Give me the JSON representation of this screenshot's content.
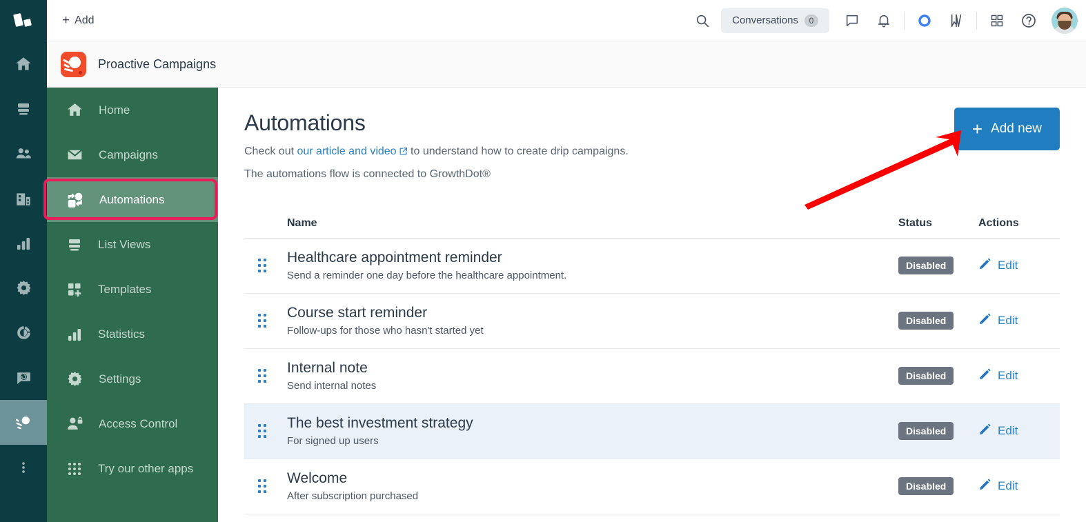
{
  "rail": {
    "logo_icon": "app-logo-icon",
    "items": [
      {
        "name": "home",
        "icon": "home-icon",
        "active": false
      },
      {
        "name": "knowledge-base",
        "icon": "book-icon",
        "active": false
      },
      {
        "name": "contacts",
        "icon": "people-icon",
        "active": false
      },
      {
        "name": "companies",
        "icon": "building-icon",
        "active": false
      },
      {
        "name": "reports",
        "icon": "bar-chart-icon",
        "active": false
      },
      {
        "name": "settings",
        "icon": "gear-icon",
        "active": false
      },
      {
        "name": "insights",
        "icon": "pie-chart-icon",
        "active": false
      },
      {
        "name": "chat",
        "icon": "chat-bubble-icon",
        "active": false
      },
      {
        "name": "proactive-campaigns",
        "icon": "comet-icon",
        "active": true
      },
      {
        "name": "more",
        "icon": "more-vertical-icon",
        "active": false
      }
    ]
  },
  "topbar": {
    "add_label": "Add",
    "add_icon": "plus-icon",
    "search_icon": "search-icon",
    "conversations_label": "Conversations",
    "conversations_count": "0",
    "chat_icon": "chat-icon",
    "bell_icon": "bell-icon",
    "ring_icon": "circle-ring-icon",
    "bookmark_icon": "bookmark-icon",
    "grid_icon": "apps-grid-icon",
    "help_icon": "question-mark-icon",
    "avatar_icon": "avatar"
  },
  "app_header": {
    "title": "Proactive Campaigns",
    "logo_icon": "proactive-campaigns-logo"
  },
  "sidebar": {
    "items": [
      {
        "label": "Home",
        "icon": "home-icon",
        "active": false
      },
      {
        "label": "Campaigns",
        "icon": "envelope-icon",
        "active": false
      },
      {
        "label": "Automations",
        "icon": "automations-flow-icon",
        "active": true
      },
      {
        "label": "List Views",
        "icon": "list-views-icon",
        "active": false
      },
      {
        "label": "Templates",
        "icon": "templates-icon",
        "active": false
      },
      {
        "label": "Statistics",
        "icon": "bar-chart-icon",
        "active": false
      },
      {
        "label": "Settings",
        "icon": "gear-icon",
        "active": false
      },
      {
        "label": "Access Control",
        "icon": "person-lock-icon",
        "active": false
      },
      {
        "label": "Try our other apps",
        "icon": "dots-grid-icon",
        "active": false
      }
    ]
  },
  "main": {
    "title": "Automations",
    "subtitle_pre": "Check out ",
    "subtitle_link": "our article and video",
    "subtitle_post": " to understand how to create drip campaigns.",
    "subtitle2": "The automations flow is connected to GrowthDot®",
    "add_new_label": "Add new",
    "add_new_icon": "plus-icon",
    "columns": {
      "name": "Name",
      "status": "Status",
      "actions": "Actions"
    },
    "edit_label": "Edit",
    "edit_icon": "pencil-icon",
    "drag_icon": "drag-handle-icon",
    "rows": [
      {
        "name": "Healthcare appointment reminder",
        "description": "Send a reminder one day before the healthcare appointment.",
        "status": "Disabled",
        "highlighted": false
      },
      {
        "name": "Course start reminder",
        "description": "Follow-ups for those who hasn't started yet",
        "status": "Disabled",
        "highlighted": false
      },
      {
        "name": "Internal note",
        "description": "Send internal notes",
        "status": "Disabled",
        "highlighted": false
      },
      {
        "name": "The best investment strategy",
        "description": "For signed up users",
        "status": "Disabled",
        "highlighted": true
      },
      {
        "name": "Welcome",
        "description": "After subscription purchased",
        "status": "Disabled",
        "highlighted": false
      }
    ]
  },
  "annotations": {
    "highlight_box_color": "#ec1b5a",
    "arrow_color": "#fa0000",
    "highlight_target": "Automations",
    "arrow_target": "Add new"
  },
  "colors": {
    "rail_bg": "#0d3d42",
    "sidebar_bg": "#2e6b4f",
    "sidebar_active_bg": "#63937b",
    "primary_button": "#1f7dc0",
    "link": "#2b7fc4",
    "badge_disabled": "#6b7480",
    "row_highlight": "#eaf1f9",
    "brand_logo": "#f04b2a"
  }
}
